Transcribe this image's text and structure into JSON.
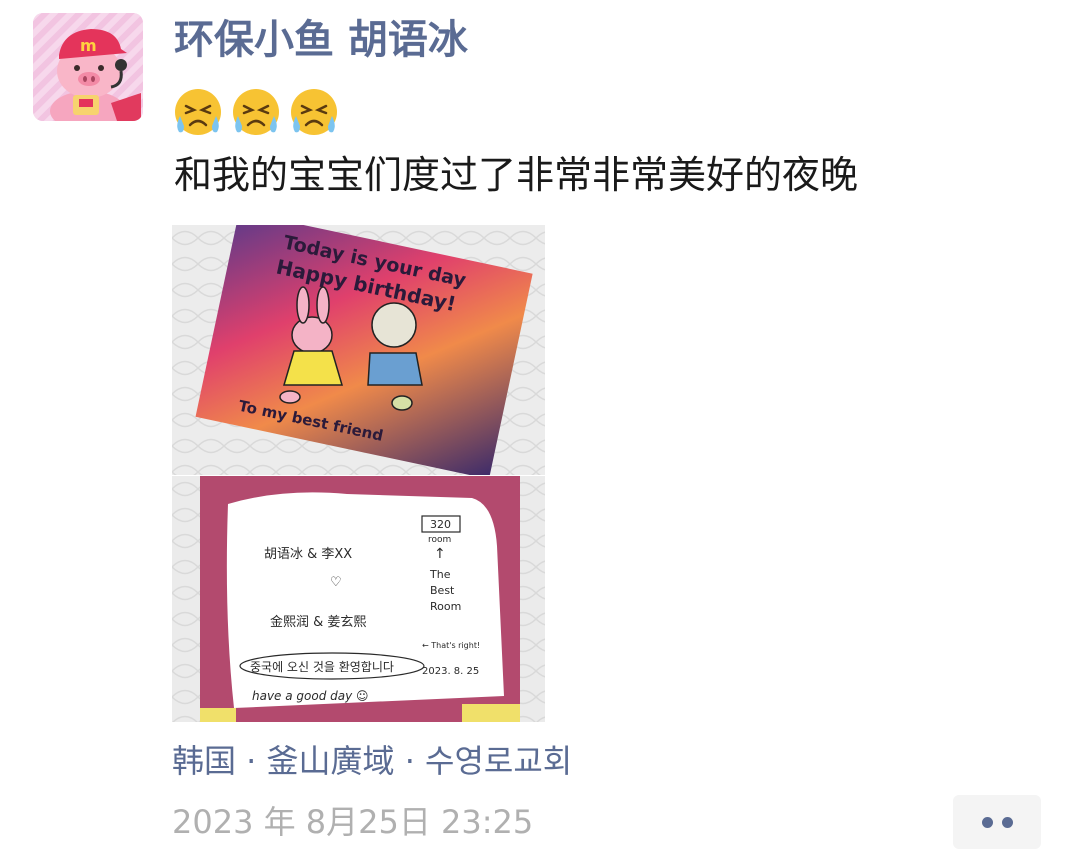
{
  "post": {
    "username": "环保小鱼 胡语冰",
    "emojis": [
      "crying-face-icon",
      "crying-face-icon",
      "crying-face-icon"
    ],
    "content": "和我的宝宝们度过了非常非常美好的夜晚",
    "location": "韩国 · 釜山廣域 · 수영로교회",
    "timestamp": "2023 年 8月25日 23:25"
  },
  "photos": {
    "card_front": {
      "line1": "Today is your day",
      "line2": "Happy birthday!",
      "line3": "To my best friend"
    },
    "card_inside": {
      "room_number": "320",
      "room_label": "room",
      "arrow": "↑",
      "best_room_1": "The",
      "best_room_2": "Best",
      "best_room_3": "Room",
      "names_1": "胡语冰 & 李XX",
      "heart": "♡",
      "names_2": "金熙润 & 姜玄熙",
      "thats_right": "← That's right!",
      "korean_welcome": "중국에 오신 것을 환영합니다",
      "date": "2023. 8. 25",
      "have_good_day": "have a good day ☺"
    }
  },
  "colors": {
    "username": "#5a6b93",
    "timestamp": "#b0b0b0",
    "avatar_bg": "#f3c9e4"
  }
}
